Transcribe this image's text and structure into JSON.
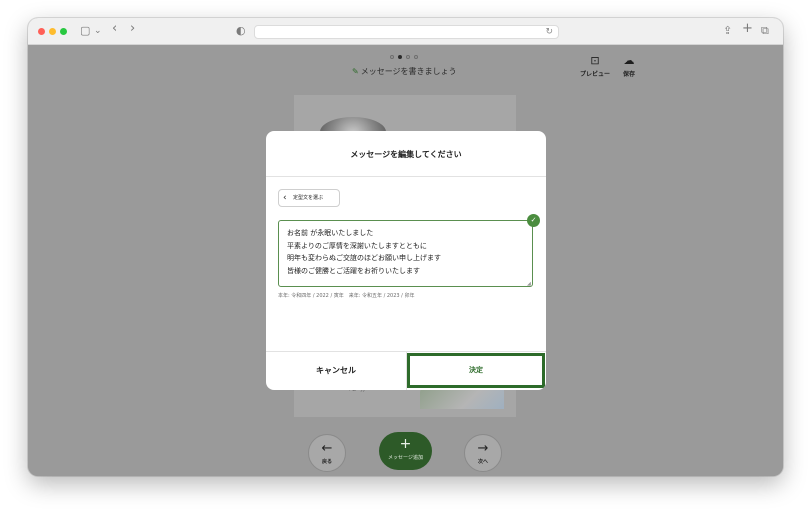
{
  "toolbar": {
    "sidebar_icon": "▢",
    "chevron_icon": "⌄",
    "back_icon": "‹",
    "forward_icon": "›",
    "shield_icon": "◐",
    "reload_icon": "↻",
    "share_icon": "⇪",
    "plus_icon": "+",
    "tabs_icon": "⧉"
  },
  "header": {
    "step_title": "メッセージを書きましょう",
    "pen_icon": "✎",
    "preview_label": "プレビュー",
    "preview_icon": "⊡",
    "save_label": "保存",
    "save_icon": "☁"
  },
  "modal": {
    "title": "メッセージを編集してください",
    "template_button_label": "定型文を選ぶ",
    "chevron_left": "‹",
    "message_lines": [
      "お名前 が永眠いたしました",
      "平素よりのご厚情を深謝いたしますとともに",
      "明年も変わらぬご交誼のほどお願い申し上げます",
      "皆様のご健勝とご活躍をお祈りいたします"
    ],
    "check_icon": "✓",
    "date_info": "本年: 令和四年 / 2022 / 寅年　来年: 令和五年 / 2023 / 卯年",
    "cancel_label": "キャンセル",
    "confirm_label": "決定"
  },
  "bottom": {
    "back_label": "戻る",
    "back_icon": "←",
    "add_label": "メッセージ追加",
    "add_icon": "+",
    "next_label": "次へ",
    "next_icon": "→"
  },
  "colors": {
    "accent_green": "#2d6b2a",
    "check_green": "#4b8d3f",
    "overlay_gray": "#9a9a9a"
  }
}
